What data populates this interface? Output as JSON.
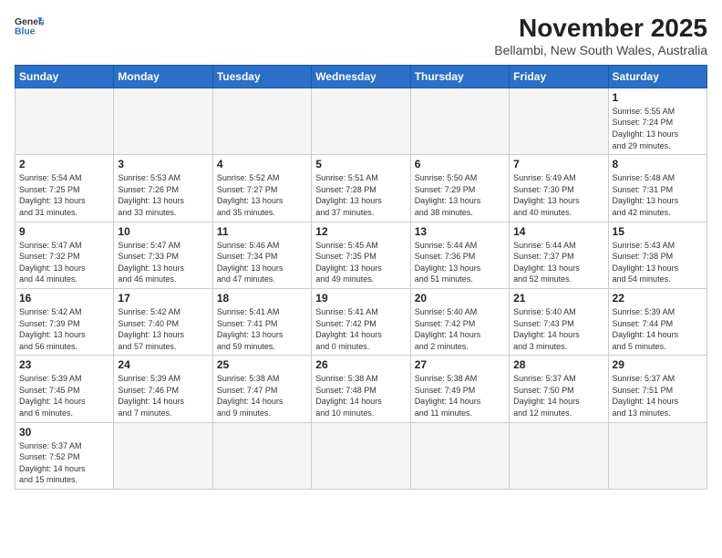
{
  "logo": {
    "line1": "General",
    "line2": "Blue"
  },
  "title": "November 2025",
  "subtitle": "Bellambi, New South Wales, Australia",
  "weekdays": [
    "Sunday",
    "Monday",
    "Tuesday",
    "Wednesday",
    "Thursday",
    "Friday",
    "Saturday"
  ],
  "weeks": [
    [
      {
        "day": "",
        "info": ""
      },
      {
        "day": "",
        "info": ""
      },
      {
        "day": "",
        "info": ""
      },
      {
        "day": "",
        "info": ""
      },
      {
        "day": "",
        "info": ""
      },
      {
        "day": "",
        "info": ""
      },
      {
        "day": "1",
        "info": "Sunrise: 5:55 AM\nSunset: 7:24 PM\nDaylight: 13 hours\nand 29 minutes."
      }
    ],
    [
      {
        "day": "2",
        "info": "Sunrise: 5:54 AM\nSunset: 7:25 PM\nDaylight: 13 hours\nand 31 minutes."
      },
      {
        "day": "3",
        "info": "Sunrise: 5:53 AM\nSunset: 7:26 PM\nDaylight: 13 hours\nand 33 minutes."
      },
      {
        "day": "4",
        "info": "Sunrise: 5:52 AM\nSunset: 7:27 PM\nDaylight: 13 hours\nand 35 minutes."
      },
      {
        "day": "5",
        "info": "Sunrise: 5:51 AM\nSunset: 7:28 PM\nDaylight: 13 hours\nand 37 minutes."
      },
      {
        "day": "6",
        "info": "Sunrise: 5:50 AM\nSunset: 7:29 PM\nDaylight: 13 hours\nand 38 minutes."
      },
      {
        "day": "7",
        "info": "Sunrise: 5:49 AM\nSunset: 7:30 PM\nDaylight: 13 hours\nand 40 minutes."
      },
      {
        "day": "8",
        "info": "Sunrise: 5:48 AM\nSunset: 7:31 PM\nDaylight: 13 hours\nand 42 minutes."
      }
    ],
    [
      {
        "day": "9",
        "info": "Sunrise: 5:47 AM\nSunset: 7:32 PM\nDaylight: 13 hours\nand 44 minutes."
      },
      {
        "day": "10",
        "info": "Sunrise: 5:47 AM\nSunset: 7:33 PM\nDaylight: 13 hours\nand 46 minutes."
      },
      {
        "day": "11",
        "info": "Sunrise: 5:46 AM\nSunset: 7:34 PM\nDaylight: 13 hours\nand 47 minutes."
      },
      {
        "day": "12",
        "info": "Sunrise: 5:45 AM\nSunset: 7:35 PM\nDaylight: 13 hours\nand 49 minutes."
      },
      {
        "day": "13",
        "info": "Sunrise: 5:44 AM\nSunset: 7:36 PM\nDaylight: 13 hours\nand 51 minutes."
      },
      {
        "day": "14",
        "info": "Sunrise: 5:44 AM\nSunset: 7:37 PM\nDaylight: 13 hours\nand 52 minutes."
      },
      {
        "day": "15",
        "info": "Sunrise: 5:43 AM\nSunset: 7:38 PM\nDaylight: 13 hours\nand 54 minutes."
      }
    ],
    [
      {
        "day": "16",
        "info": "Sunrise: 5:42 AM\nSunset: 7:39 PM\nDaylight: 13 hours\nand 56 minutes."
      },
      {
        "day": "17",
        "info": "Sunrise: 5:42 AM\nSunset: 7:40 PM\nDaylight: 13 hours\nand 57 minutes."
      },
      {
        "day": "18",
        "info": "Sunrise: 5:41 AM\nSunset: 7:41 PM\nDaylight: 13 hours\nand 59 minutes."
      },
      {
        "day": "19",
        "info": "Sunrise: 5:41 AM\nSunset: 7:42 PM\nDaylight: 14 hours\nand 0 minutes."
      },
      {
        "day": "20",
        "info": "Sunrise: 5:40 AM\nSunset: 7:42 PM\nDaylight: 14 hours\nand 2 minutes."
      },
      {
        "day": "21",
        "info": "Sunrise: 5:40 AM\nSunset: 7:43 PM\nDaylight: 14 hours\nand 3 minutes."
      },
      {
        "day": "22",
        "info": "Sunrise: 5:39 AM\nSunset: 7:44 PM\nDaylight: 14 hours\nand 5 minutes."
      }
    ],
    [
      {
        "day": "23",
        "info": "Sunrise: 5:39 AM\nSunset: 7:45 PM\nDaylight: 14 hours\nand 6 minutes."
      },
      {
        "day": "24",
        "info": "Sunrise: 5:39 AM\nSunset: 7:46 PM\nDaylight: 14 hours\nand 7 minutes."
      },
      {
        "day": "25",
        "info": "Sunrise: 5:38 AM\nSunset: 7:47 PM\nDaylight: 14 hours\nand 9 minutes."
      },
      {
        "day": "26",
        "info": "Sunrise: 5:38 AM\nSunset: 7:48 PM\nDaylight: 14 hours\nand 10 minutes."
      },
      {
        "day": "27",
        "info": "Sunrise: 5:38 AM\nSunset: 7:49 PM\nDaylight: 14 hours\nand 11 minutes."
      },
      {
        "day": "28",
        "info": "Sunrise: 5:37 AM\nSunset: 7:50 PM\nDaylight: 14 hours\nand 12 minutes."
      },
      {
        "day": "29",
        "info": "Sunrise: 5:37 AM\nSunset: 7:51 PM\nDaylight: 14 hours\nand 13 minutes."
      }
    ],
    [
      {
        "day": "30",
        "info": "Sunrise: 5:37 AM\nSunset: 7:52 PM\nDaylight: 14 hours\nand 15 minutes."
      },
      {
        "day": "",
        "info": ""
      },
      {
        "day": "",
        "info": ""
      },
      {
        "day": "",
        "info": ""
      },
      {
        "day": "",
        "info": ""
      },
      {
        "day": "",
        "info": ""
      },
      {
        "day": "",
        "info": ""
      }
    ]
  ]
}
